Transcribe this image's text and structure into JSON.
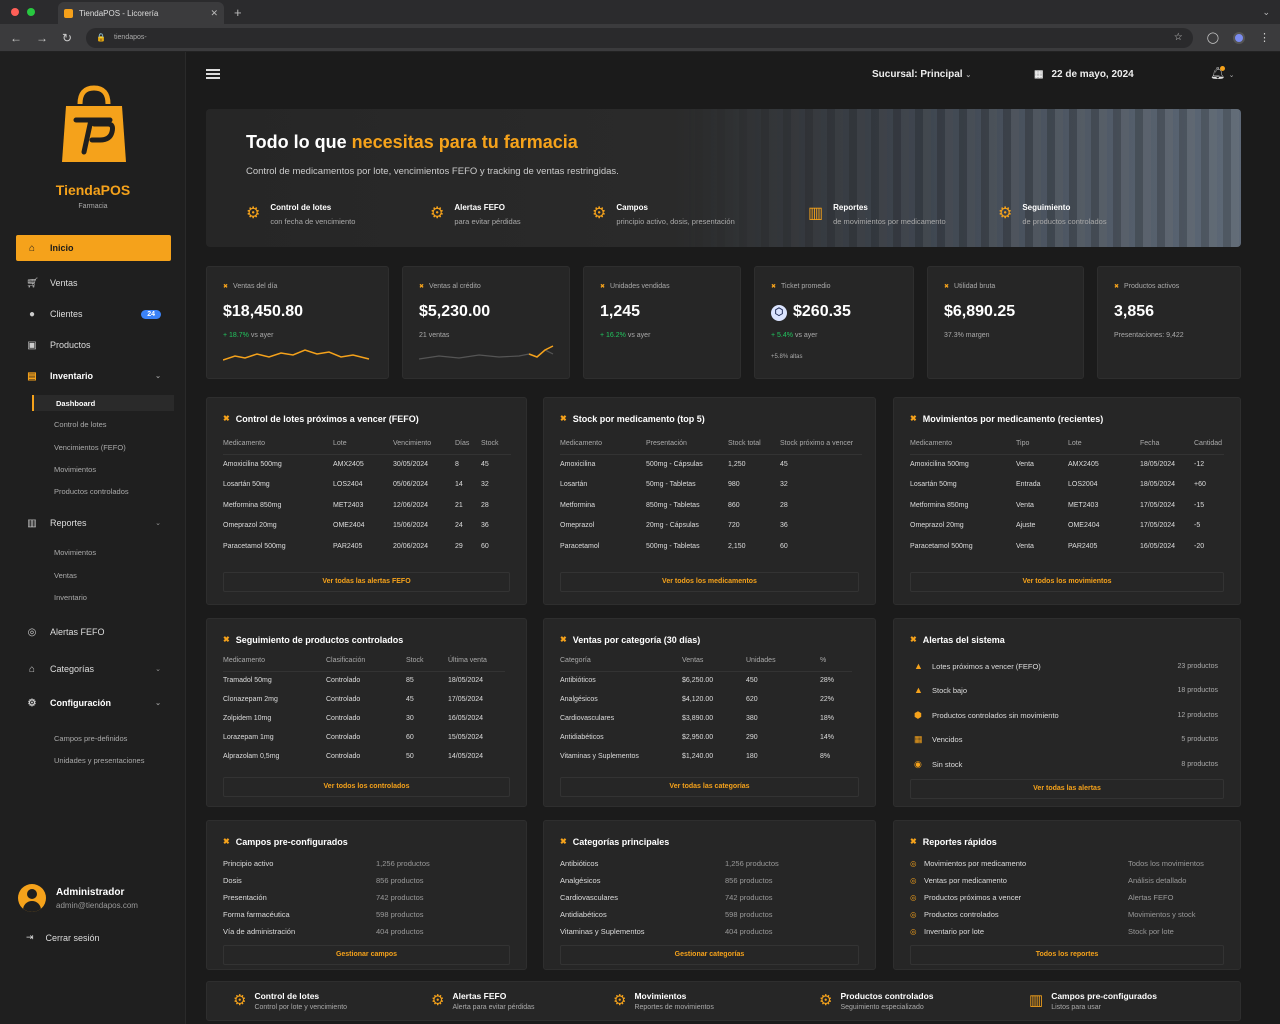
{
  "browser": {
    "tab_title": "TiendaPOS - Licorería",
    "url": "tiendapos-"
  },
  "brand": {
    "name": "TiendaPOS",
    "subtitle": "Farmacia"
  },
  "sidebar": {
    "items": [
      {
        "label": "Inicio",
        "icon": "home-icon"
      },
      {
        "label": "Ventas",
        "icon": "cart-icon"
      },
      {
        "label": "Clientes",
        "icon": "users-icon",
        "badge": "24"
      },
      {
        "label": "Productos",
        "icon": "box-icon"
      },
      {
        "label": "Inventario",
        "icon": "inventory-icon"
      },
      {
        "label": "Reportes",
        "icon": "reports-icon"
      },
      {
        "label": "Alertas FEFO",
        "icon": "alert-icon"
      },
      {
        "label": "Categorías",
        "icon": "tag-icon"
      },
      {
        "label": "Configuración",
        "icon": "gear-icon"
      }
    ],
    "inventario_sub": [
      "Dashboard",
      "Control de lotes",
      "Vencimientos (FEFO)",
      "Movimientos",
      "Productos controlados"
    ],
    "reportes_sub": [
      "Movimientos",
      "Ventas",
      "Inventario"
    ],
    "config_sub": [
      "Campos pre-definidos",
      "Unidades y presentaciones"
    ],
    "user": {
      "name": "Administrador",
      "email": "admin@tiendapos.com"
    },
    "logout": "Cerrar sesión"
  },
  "topbar": {
    "branch": "Sucursal: Principal",
    "date": "22 de mayo, 2024"
  },
  "hero": {
    "title_a": "Todo lo que ",
    "title_b": "necesitas",
    "title_c": " para tu farmacia",
    "subtitle": "Control de medicamentos por lote, vencimientos FEFO y tracking de ventas restringidas.",
    "features": [
      {
        "title": "Control de lotes",
        "sub": "con fecha de vencimiento"
      },
      {
        "title": "Alertas FEFO",
        "sub": "para evitar pérdidas"
      },
      {
        "title": "Campos",
        "sub": "principio activo, dosis, presentación"
      },
      {
        "title": "Reportes",
        "sub": "de movimientos por medicamento"
      },
      {
        "title": "Seguimiento",
        "sub": "de productos controlados"
      }
    ]
  },
  "kpis": [
    {
      "label": "Ventas del día",
      "value": "$18,450.80",
      "delta": "+ 18.7%",
      "note": " vs ayer"
    },
    {
      "label": "Ventas al crédito",
      "value": "$5,230.00",
      "delta": "",
      "note": "21 ventas"
    },
    {
      "label": "Unidades vendidas",
      "value": "1,245",
      "delta": "+ 16.2%",
      "note": " vs ayer"
    },
    {
      "label": "Ticket promedio",
      "value": "$260.35",
      "delta": "+ 5.4%",
      "note": " vs ayer",
      "extra": "+5.8% altas"
    },
    {
      "label": "Utilidad bruta",
      "value": "$6,890.25",
      "delta": "",
      "note": "37.3% margen"
    },
    {
      "label": "Productos activos",
      "value": "3,856",
      "delta": "",
      "note": "Presentaciones: 9,422"
    }
  ],
  "fefo": {
    "title": "Control de lotes próximos a vencer (FEFO)",
    "headers": [
      "Medicamento",
      "Lote",
      "Vencimiento",
      "Días",
      "Stock"
    ],
    "rows": [
      [
        "Amoxicilina 500mg",
        "AMX2405",
        "30/05/2024",
        "8",
        "45"
      ],
      [
        "Losartán 50mg",
        "LOS2404",
        "05/06/2024",
        "14",
        "32"
      ],
      [
        "Metformina 850mg",
        "MET2403",
        "12/06/2024",
        "21",
        "28"
      ],
      [
        "Omeprazol 20mg",
        "OME2404",
        "15/06/2024",
        "24",
        "36"
      ],
      [
        "Paracetamol 500mg",
        "PAR2405",
        "20/06/2024",
        "29",
        "60"
      ]
    ],
    "footer": "Ver todas las alertas FEFO"
  },
  "stock": {
    "title": "Stock por medicamento (top 5)",
    "headers": [
      "Medicamento",
      "Presentación",
      "Stock total",
      "Stock próximo a vencer"
    ],
    "rows": [
      [
        "Amoxicilina",
        "500mg - Cápsulas",
        "1,250",
        "45"
      ],
      [
        "Losartán",
        "50mg - Tabletas",
        "980",
        "32"
      ],
      [
        "Metformina",
        "850mg - Tabletas",
        "860",
        "28"
      ],
      [
        "Omeprazol",
        "20mg - Cápsulas",
        "720",
        "36"
      ],
      [
        "Paracetamol",
        "500mg - Tabletas",
        "2,150",
        "60"
      ]
    ],
    "footer": "Ver todos los medicamentos"
  },
  "movs": {
    "title": "Movimientos por medicamento (recientes)",
    "headers": [
      "Medicamento",
      "Tipo",
      "Lote",
      "Fecha",
      "Cantidad"
    ],
    "rows": [
      [
        "Amoxicilina 500mg",
        "Venta",
        "AMX2405",
        "18/05/2024",
        "-12"
      ],
      [
        "Losartán 50mg",
        "Entrada",
        "LOS2004",
        "18/05/2024",
        "+60"
      ],
      [
        "Metformina 850mg",
        "Venta",
        "MET2403",
        "17/05/2024",
        "-15"
      ],
      [
        "Omeprazol 20mg",
        "Ajuste",
        "OME2404",
        "17/05/2024",
        "-5"
      ],
      [
        "Paracetamol 500mg",
        "Venta",
        "PAR2405",
        "16/05/2024",
        "-20"
      ]
    ],
    "footer": "Ver todos los movimientos"
  },
  "controlled": {
    "title": "Seguimiento de productos controlados",
    "headers": [
      "Medicamento",
      "Clasificación",
      "Stock",
      "Última venta"
    ],
    "rows": [
      [
        "Tramadol 50mg",
        "Controlado",
        "85",
        "18/05/2024"
      ],
      [
        "Clonazepam 2mg",
        "Controlado",
        "45",
        "17/05/2024"
      ],
      [
        "Zolpidem 10mg",
        "Controlado",
        "30",
        "16/05/2024"
      ],
      [
        "Lorazepam 1mg",
        "Controlado",
        "60",
        "15/05/2024"
      ],
      [
        "Alprazolam 0,5mg",
        "Controlado",
        "50",
        "14/05/2024"
      ]
    ],
    "footer": "Ver todos los controlados"
  },
  "sales_cat": {
    "title": "Ventas por categoría (30 días)",
    "headers": [
      "Categoría",
      "Ventas",
      "Unidades",
      "%"
    ],
    "rows": [
      [
        "Antibióticos",
        "$6,250.00",
        "450",
        "28%"
      ],
      [
        "Analgésicos",
        "$4,120.00",
        "620",
        "22%"
      ],
      [
        "Cardiovasculares",
        "$3,890.00",
        "380",
        "18%"
      ],
      [
        "Antidiabéticos",
        "$2,950.00",
        "290",
        "14%"
      ],
      [
        "Vitaminas y Suplementos",
        "$1,240.00",
        "180",
        "8%"
      ]
    ],
    "footer": "Ver todas las categorías"
  },
  "alerts": {
    "title": "Alertas del sistema",
    "rows": [
      {
        "label": "Lotes próximos a vencer (FEFO)",
        "count": "23 productos",
        "icon": "warning-icon"
      },
      {
        "label": "Stock bajo",
        "count": "18 productos",
        "icon": "warning-icon"
      },
      {
        "label": "Productos controlados sin movimiento",
        "count": "12 productos",
        "icon": "shield-icon"
      },
      {
        "label": "Vencidos",
        "count": "5 productos",
        "icon": "calendar-icon"
      },
      {
        "label": "Sin stock",
        "count": "8 productos",
        "icon": "circle-icon"
      }
    ],
    "footer": "Ver todas las alertas"
  },
  "fields": {
    "title": "Campos pre-configurados",
    "rows": [
      [
        "Principio activo",
        "1,256 productos"
      ],
      [
        "Dosis",
        "856 productos"
      ],
      [
        "Presentación",
        "742 productos"
      ],
      [
        "Forma farmacéutica",
        "598 productos"
      ],
      [
        "Vía de administración",
        "404 productos"
      ]
    ],
    "footer": "Gestionar campos"
  },
  "cats": {
    "title": "Categorías principales",
    "rows": [
      [
        "Antibióticos",
        "1,256 productos"
      ],
      [
        "Analgésicos",
        "856 productos"
      ],
      [
        "Cardiovasculares",
        "742 productos"
      ],
      [
        "Antidiabéticos",
        "598 productos"
      ],
      [
        "Vitaminas y Suplementos",
        "404 productos"
      ]
    ],
    "footer": "Gestionar categorías"
  },
  "quick": {
    "title": "Reportes rápidos",
    "rows": [
      [
        "Movimientos por medicamento",
        "Todos los movimientos"
      ],
      [
        "Ventas por medicamento",
        "Análisis detallado"
      ],
      [
        "Productos próximos a vencer",
        "Alertas FEFO"
      ],
      [
        "Productos controlados",
        "Movimientos y stock"
      ],
      [
        "Inventario por lote",
        "Stock por lote"
      ]
    ],
    "footer": "Todos los reportes"
  },
  "bottom": [
    {
      "title": "Control de lotes",
      "sub": "Control por lote y vencimiento"
    },
    {
      "title": "Alertas FEFO",
      "sub": "Alerta para evitar pérdidas"
    },
    {
      "title": "Movimientos",
      "sub": "Reportes de movimientos"
    },
    {
      "title": "Productos controlados",
      "sub": "Seguimiento especializado"
    },
    {
      "title": "Campos pre-configurados",
      "sub": "Listos para usar"
    }
  ],
  "colors": {
    "accent": "#f5a21b",
    "positive": "#22c55e",
    "badge": "#3b82f6"
  }
}
